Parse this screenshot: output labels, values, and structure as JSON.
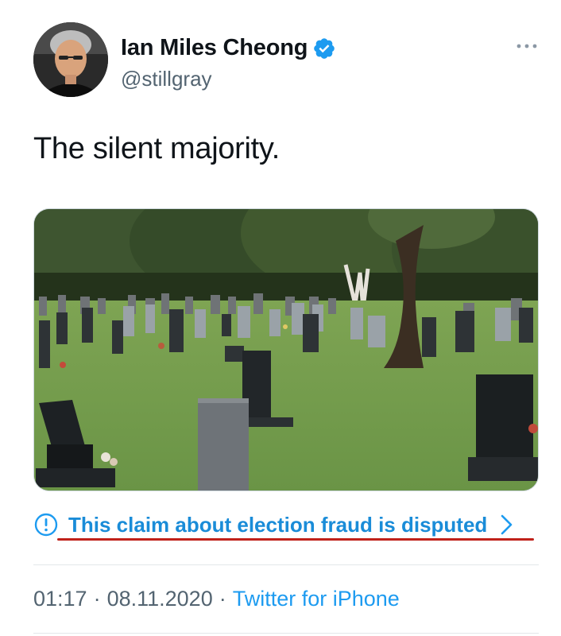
{
  "tweet": {
    "author": {
      "display_name": "Ian Miles Cheong",
      "handle": "@stillgray",
      "verified_icon": "verified-badge-icon"
    },
    "more_icon": "more-horizontal-icon",
    "text": "The silent majority.",
    "media": {
      "kind": "photo"
    },
    "notice": {
      "icon": "info-circle-icon",
      "text": "This claim about election fraud is disputed",
      "chevron": "chevron-right-icon",
      "underline_color": "#c0211a"
    },
    "meta": {
      "time": "01:17",
      "separator": "·",
      "date": "08.11.2020",
      "source": "Twitter for iPhone"
    }
  },
  "colors": {
    "accent": "#1d9bf0",
    "text_primary": "#0f1419",
    "text_secondary": "#536471"
  }
}
